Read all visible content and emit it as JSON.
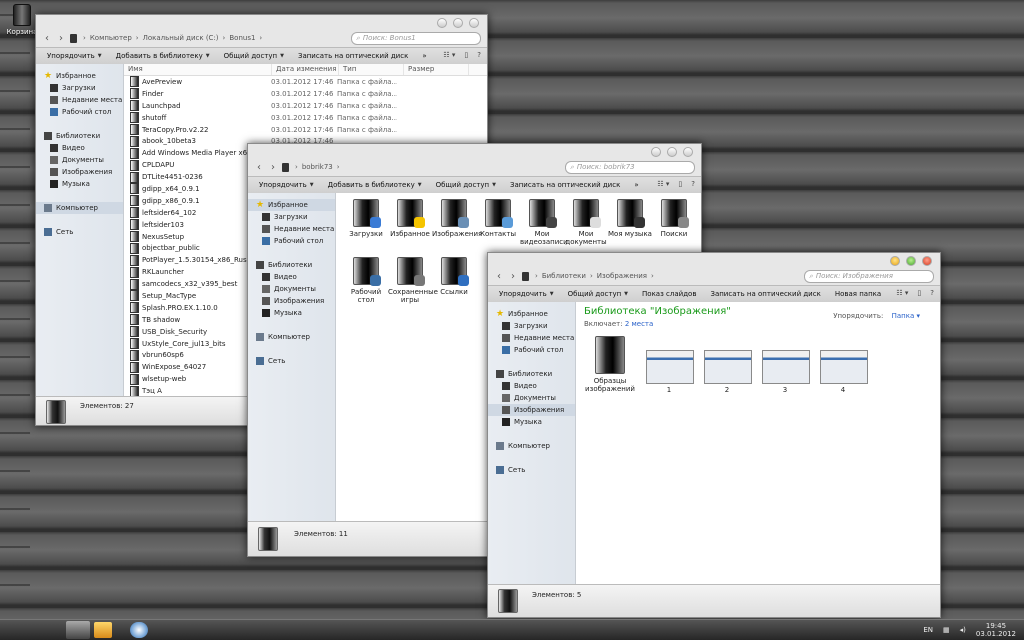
{
  "desktop": {
    "recycle_bin_label": "Корзина"
  },
  "win1": {
    "crumbs": [
      "Компьютер",
      "Локальный диск (C:)",
      "Bonus1"
    ],
    "search_placeholder": "Поиск: Bonus1",
    "toolbar": [
      "Упорядочить",
      "Добавить в библиотеку",
      "Общий доступ",
      "Записать на оптический диск",
      "»"
    ],
    "sidebar": {
      "favorites": "Избранное",
      "fav_items": [
        "Загрузки",
        "Недавние места",
        "Рабочий стол"
      ],
      "libraries": "Библиотеки",
      "lib_items": [
        "Видео",
        "Документы",
        "Изображения",
        "Музыка"
      ],
      "computer": "Компьютер",
      "network": "Сеть"
    },
    "columns": [
      "Имя",
      "Дата изменения",
      "Тип",
      "Размер"
    ],
    "rows": [
      {
        "name": "AvePreview",
        "date": "03.01.2012 17:46",
        "type": "Папка с файла..."
      },
      {
        "name": "Finder",
        "date": "03.01.2012 17:46",
        "type": "Папка с файла..."
      },
      {
        "name": "Launchpad",
        "date": "03.01.2012 17:46",
        "type": "Папка с файла..."
      },
      {
        "name": "shutoff",
        "date": "03.01.2012 17:46",
        "type": "Папка с файла..."
      },
      {
        "name": "TeraCopy.Pro.v2.22",
        "date": "03.01.2012 17:46",
        "type": "Папка с файла..."
      },
      {
        "name": "abook_10beta3",
        "date": "03.01.2012 17:46",
        "type": ""
      },
      {
        "name": "Add Windows Media Player x64",
        "date": "",
        "type": ""
      },
      {
        "name": "CPLDAPU",
        "date": "",
        "type": ""
      },
      {
        "name": "DTLite4451-0236",
        "date": "",
        "type": ""
      },
      {
        "name": "gdipp_x64_0.9.1",
        "date": "",
        "type": ""
      },
      {
        "name": "gdipp_x86_0.9.1",
        "date": "",
        "type": ""
      },
      {
        "name": "leftsider64_102",
        "date": "",
        "type": ""
      },
      {
        "name": "leftsider103",
        "date": "",
        "type": ""
      },
      {
        "name": "NexusSetup",
        "date": "",
        "type": ""
      },
      {
        "name": "objectbar_public",
        "date": "",
        "type": ""
      },
      {
        "name": "PotPlayer_1.5.30154_x86_Rus",
        "date": "",
        "type": ""
      },
      {
        "name": "RKLauncher",
        "date": "",
        "type": ""
      },
      {
        "name": "samcodecs_x32_v395_best",
        "date": "",
        "type": ""
      },
      {
        "name": "Setup_MacType",
        "date": "",
        "type": ""
      },
      {
        "name": "Splash.PRO.EX.1.10.0",
        "date": "",
        "type": ""
      },
      {
        "name": "TB shadow",
        "date": "",
        "type": ""
      },
      {
        "name": "USB_Disk_Security",
        "date": "",
        "type": ""
      },
      {
        "name": "UxStyle_Core_jul13_bits",
        "date": "",
        "type": ""
      },
      {
        "name": "vbrun60sp6",
        "date": "",
        "type": ""
      },
      {
        "name": "WinExpose_64027",
        "date": "",
        "type": ""
      },
      {
        "name": "wlsetup-web",
        "date": "",
        "type": ""
      },
      {
        "name": "Тэц А",
        "date": "",
        "type": ""
      }
    ],
    "status": "Элементов: 27"
  },
  "win2": {
    "crumbs": [
      "bobrik73"
    ],
    "search_placeholder": "Поиск: bobrik73",
    "toolbar": [
      "Упорядочить",
      "Добавить в библиотеку",
      "Общий доступ",
      "Записать на оптический диск",
      "»"
    ],
    "sidebar": {
      "favorites": "Избранное",
      "fav_items": [
        "Загрузки",
        "Недавние места",
        "Рабочий стол"
      ],
      "libraries": "Библиотеки",
      "lib_items": [
        "Видео",
        "Документы",
        "Изображения",
        "Музыка"
      ],
      "computer": "Компьютер",
      "network": "Сеть"
    },
    "items": [
      {
        "label": "Загрузки",
        "badge": "#3a7bd5"
      },
      {
        "label": "Избранное",
        "badge": "#f5c400"
      },
      {
        "label": "Изображения",
        "badge": "#6a8fb5"
      },
      {
        "label": "Контакты",
        "badge": "#5a9bd8"
      },
      {
        "label": "Мои видеозаписи",
        "badge": "#444444"
      },
      {
        "label": "Мои документы",
        "badge": "#dddddd"
      },
      {
        "label": "Моя музыка",
        "badge": "#333333"
      },
      {
        "label": "Поиски",
        "badge": "#888888"
      },
      {
        "label": "Рабочий стол",
        "badge": "#3a6ea5"
      },
      {
        "label": "Сохраненные игры",
        "badge": "#777777"
      },
      {
        "label": "Ссылки",
        "badge": "#2f6fc0"
      }
    ],
    "status": "Элементов: 11"
  },
  "win3": {
    "crumbs": [
      "Библиотеки",
      "Изображения"
    ],
    "search_placeholder": "Поиск: Изображения",
    "toolbar": [
      "Упорядочить",
      "Общий доступ",
      "Показ слайдов",
      "Записать на оптический диск",
      "Новая папка"
    ],
    "sidebar": {
      "favorites": "Избранное",
      "fav_items": [
        "Загрузки",
        "Недавние места",
        "Рабочий стол"
      ],
      "libraries": "Библиотеки",
      "lib_items": [
        "Видео",
        "Документы",
        "Изображения",
        "Музыка"
      ],
      "computer": "Компьютер",
      "network": "Сеть"
    },
    "library_title": "Библиотека \"Изображения\"",
    "includes_label": "Включает:",
    "includes_value": "2 места",
    "arrange_label": "Упорядочить:",
    "arrange_value": "Папка",
    "folder_label": "Образцы изображений",
    "thumbs": [
      "1",
      "2",
      "3",
      "4"
    ],
    "status": "Элементов: 5"
  },
  "taskbar": {
    "lang": "EN",
    "time": "19:45",
    "date": "03.01.2012"
  },
  "colors": {
    "accent_green": "#1a9a1a",
    "link_blue": "#2a62c9"
  }
}
